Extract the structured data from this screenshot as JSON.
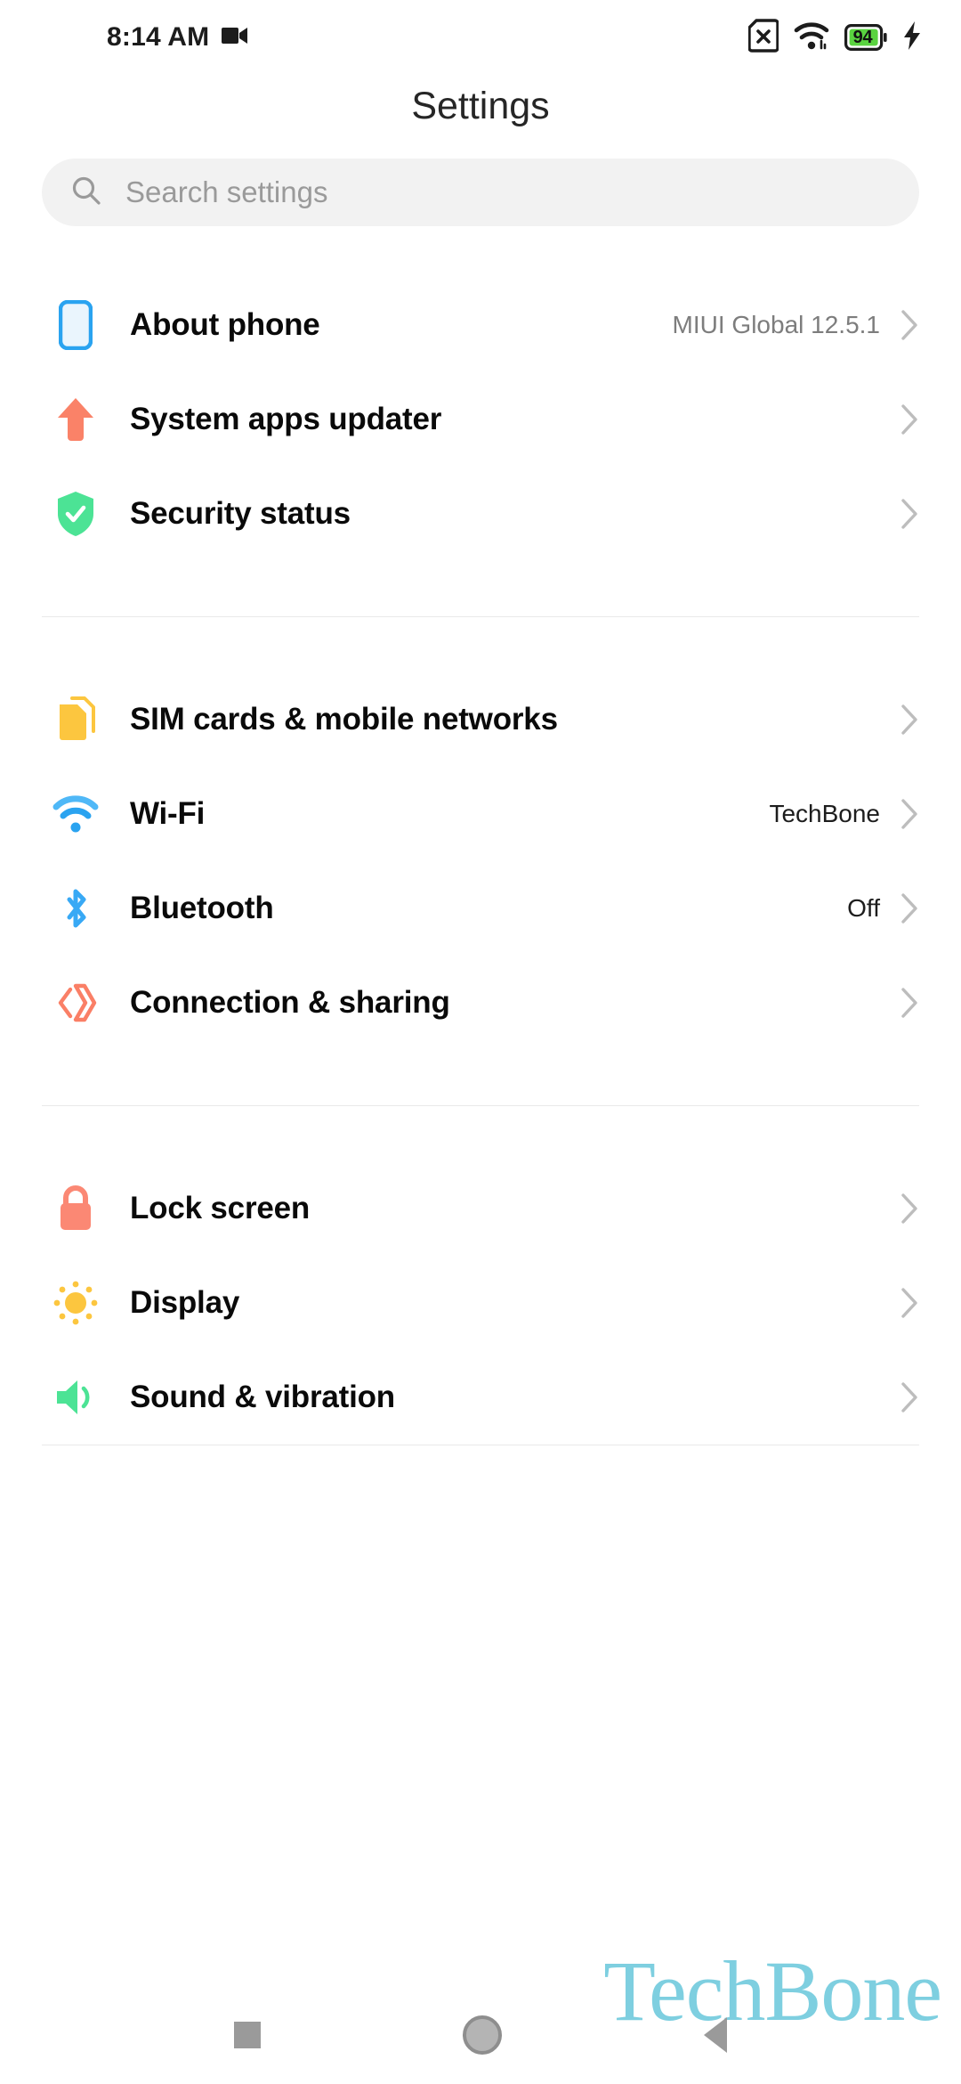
{
  "status_bar": {
    "time": "8:14 AM",
    "left_icons": [
      "video-camera-icon"
    ],
    "right_icons": [
      "sim-card-missing-icon",
      "wifi-icon",
      "battery-icon",
      "charging-bolt-icon"
    ],
    "battery_percent": "94",
    "battery_color": "#5ad340",
    "charging": true
  },
  "header": {
    "title": "Settings"
  },
  "search": {
    "placeholder": "Search settings",
    "icon": "search-icon",
    "value": ""
  },
  "groups": [
    {
      "id": "device-info",
      "rows": [
        {
          "label": "About phone",
          "value": "MIUI Global 12.5.1",
          "value_style": "muted",
          "icon": "phone-outline-icon",
          "color": "#2aa3f0"
        },
        {
          "label": "System apps updater",
          "value": "",
          "value_style": "muted",
          "icon": "up-arrow-icon",
          "color": "#fa8268"
        },
        {
          "label": "Security status",
          "value": "",
          "value_style": "muted",
          "icon": "shield-check-icon",
          "color": "#4ce395"
        }
      ]
    },
    {
      "id": "connectivity",
      "rows": [
        {
          "label": "SIM cards & mobile networks",
          "value": "",
          "value_style": "muted",
          "icon": "sim-cards-icon",
          "color": "#fcc63f"
        },
        {
          "label": "Wi-Fi",
          "value": "TechBone",
          "value_style": "dark",
          "icon": "wifi-icon",
          "color": "#38a9f5"
        },
        {
          "label": "Bluetooth",
          "value": "Off",
          "value_style": "dark",
          "icon": "bluetooth-icon",
          "color": "#38a9f5"
        },
        {
          "label": "Connection & sharing",
          "value": "",
          "value_style": "muted",
          "icon": "connection-sharing-icon",
          "color": "#fa7f66"
        }
      ]
    },
    {
      "id": "personalization",
      "rows": [
        {
          "label": "Lock screen",
          "value": "",
          "value_style": "muted",
          "icon": "lock-icon",
          "color": "#fb8874"
        },
        {
          "label": "Display",
          "value": "",
          "value_style": "muted",
          "icon": "sun-icon",
          "color": "#fcc63f"
        },
        {
          "label": "Sound & vibration",
          "value": "",
          "value_style": "muted",
          "icon": "speaker-icon",
          "color": "#4ce395"
        }
      ]
    }
  ],
  "nav_bar": {
    "recents_label": "recents-button",
    "home_label": "home-button",
    "back_label": "back-button"
  },
  "watermark": {
    "text": "TechBone",
    "color": "#7ecfe0"
  }
}
